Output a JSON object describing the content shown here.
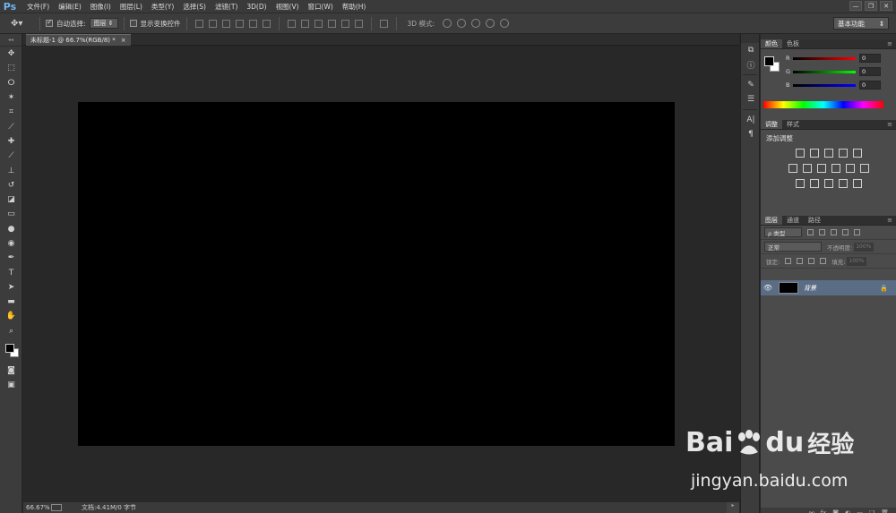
{
  "app": {
    "logo": "Ps"
  },
  "menu": [
    "文件(F)",
    "编辑(E)",
    "图像(I)",
    "图层(L)",
    "类型(Y)",
    "选择(S)",
    "滤镜(T)",
    "3D(D)",
    "视图(V)",
    "窗口(W)",
    "帮助(H)"
  ],
  "window_controls": [
    "—",
    "❐",
    "✕"
  ],
  "options": {
    "tool_icon": "move-tool",
    "auto_select_label": "自动选择:",
    "auto_select_checked": true,
    "auto_select_value": "图层",
    "show_transform_label": "显示变换控件",
    "show_transform_checked": false,
    "mode3d_label": "3D 模式:",
    "workspace": "基本功能"
  },
  "document": {
    "tab_title": "未标题-1 @ 66.7%(RGB/8) *",
    "tab_close": "×",
    "canvas_color": "#000000"
  },
  "status": {
    "zoom": "66.67%",
    "doc_info": "文档:4.41M/0 字节"
  },
  "panels": {
    "color": {
      "tabs": [
        "颜色",
        "色板"
      ],
      "r": {
        "label": "R",
        "value": "0"
      },
      "g": {
        "label": "G",
        "value": "0"
      },
      "b": {
        "label": "B",
        "value": "0"
      }
    },
    "adjustments": {
      "tabs": [
        "调整",
        "样式"
      ],
      "title": "添加调整"
    },
    "layers": {
      "tabs": [
        "图层",
        "通道",
        "路径"
      ],
      "filter_label": "ρ 类型",
      "blend_mode": "正常",
      "opacity_label": "不透明度:",
      "opacity_value": "100%",
      "lock_label": "锁定:",
      "fill_label": "填充:",
      "fill_value": "100%",
      "layer_name": "背景"
    }
  },
  "watermark": {
    "brand": "Bai",
    "brand2": "du",
    "cn": "经验",
    "url": "jingyan.baidu.com"
  },
  "colors": {
    "menubar": "#3a3a3a",
    "panel": "#4b4b4b",
    "canvas_bg": "#282828",
    "layer_selected": "#5b6d85",
    "ps_blue": "#6fb6f0"
  }
}
